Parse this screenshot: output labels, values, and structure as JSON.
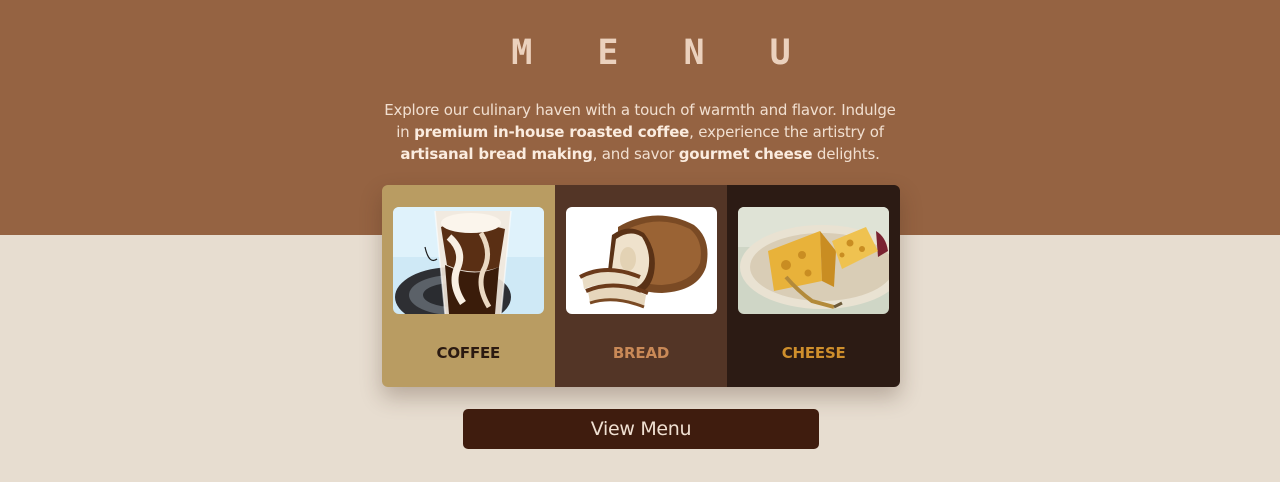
{
  "page": {
    "title": "M E N U",
    "intro": {
      "t1": "Explore our culinary haven with a touch of warmth and flavor. Indulge in ",
      "b1": "premium in-house roasted coffee",
      "t2": ", experience the artistry of ",
      "b2": "artisanal bread making",
      "t3": ", and savor ",
      "b3": "gourmet cheese",
      "t4": " delights."
    }
  },
  "cards": [
    {
      "label": "COFFEE",
      "image": "iced-coffee-image"
    },
    {
      "label": "BREAD",
      "image": "bread-loaf-image"
    },
    {
      "label": "CHEESE",
      "image": "cheese-plate-image"
    }
  ],
  "actions": {
    "view_menu_label": "View Menu"
  },
  "colors": {
    "top_band": "#956342",
    "page_bg": "#e7ddd0",
    "coffee_card": "#b99c62",
    "bread_card": "#533526",
    "cheese_card": "#2c1b14",
    "button_bg": "#3f1c0e"
  }
}
